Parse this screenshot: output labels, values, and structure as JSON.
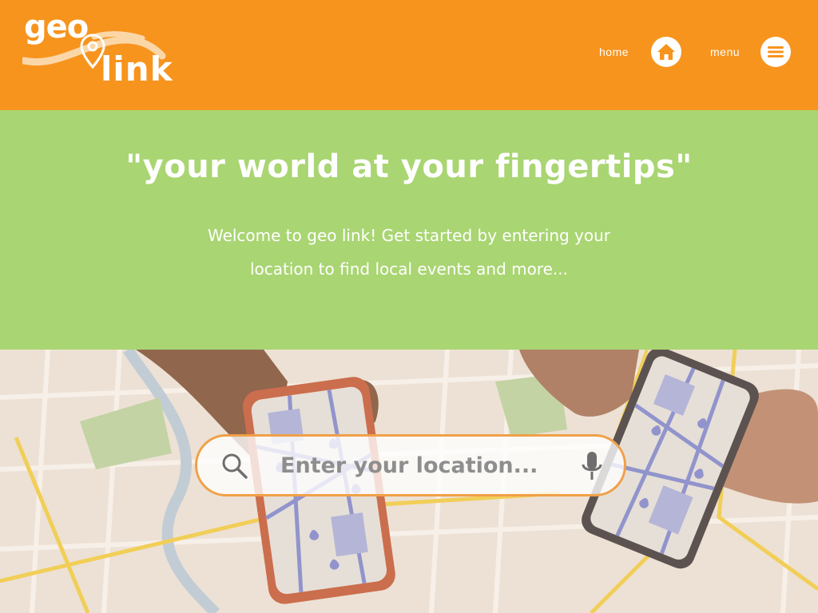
{
  "brand": {
    "logo_word_1": "geo",
    "logo_word_2": "link"
  },
  "nav": {
    "home_label": "home",
    "menu_label": "menu",
    "home_icon": "home-icon",
    "menu_icon": "menu-icon"
  },
  "hero": {
    "tagline": "\"your world at your fingertips\"",
    "intro_line_1": "Welcome to geo link! Get started by entering your",
    "intro_line_2": "location to find local events and more..."
  },
  "search": {
    "placeholder": "Enter your location...",
    "value": "",
    "search_icon": "search-icon",
    "mic_icon": "microphone-icon"
  },
  "colors": {
    "header": "#f7941e",
    "hero": "#a9d572",
    "text": "#ffffff",
    "search_border": "#f0a048"
  }
}
